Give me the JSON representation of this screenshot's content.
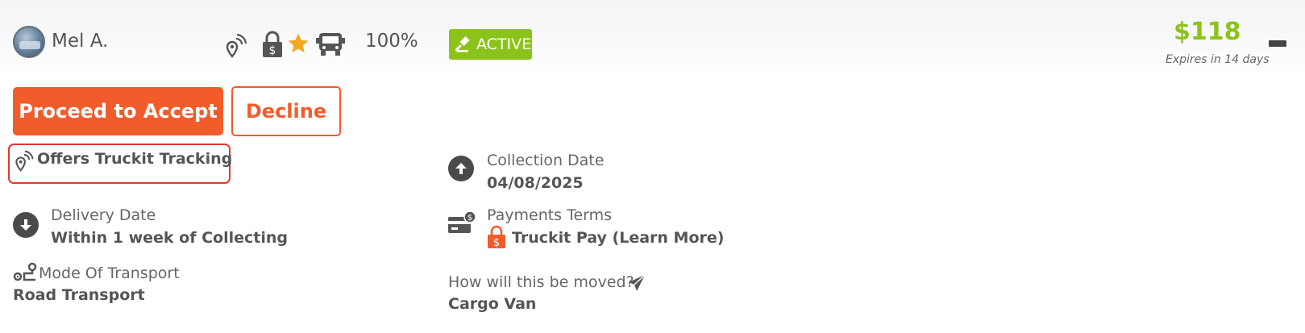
{
  "user": {
    "name": "Mel A."
  },
  "indicators": {
    "tracking_icon": "location-signal-icon",
    "lock_icon": "lock-dollar-icon",
    "star_icon": "star-icon",
    "truck_icon": "truck-icon",
    "rating": "100%"
  },
  "status": {
    "label": "ACTIVE",
    "color": "#8cc31a",
    "icon": "gavel-icon"
  },
  "offer": {
    "price": "$118",
    "expires": "Expires in 14 days"
  },
  "actions": {
    "accept_label": "Proceed to Accept",
    "decline_label": "Decline"
  },
  "colors": {
    "brand_orange": "#f25c2a",
    "active_green": "#8cc31a",
    "highlight_red": "#e03a2d"
  },
  "details": {
    "tracking": "Offers Truckit Tracking",
    "delivery": {
      "label": "Delivery Date",
      "value": "Within 1 week of Collecting"
    },
    "mode": {
      "label": "Mode Of Transport",
      "value": "Road Transport"
    },
    "collection": {
      "label": "Collection Date",
      "value": "04/08/2025"
    },
    "payments": {
      "label": "Payments Terms",
      "value": "Truckit Pay (Learn More)"
    },
    "moved": {
      "label": "How will this be moved?",
      "value": "Cargo Van"
    }
  }
}
